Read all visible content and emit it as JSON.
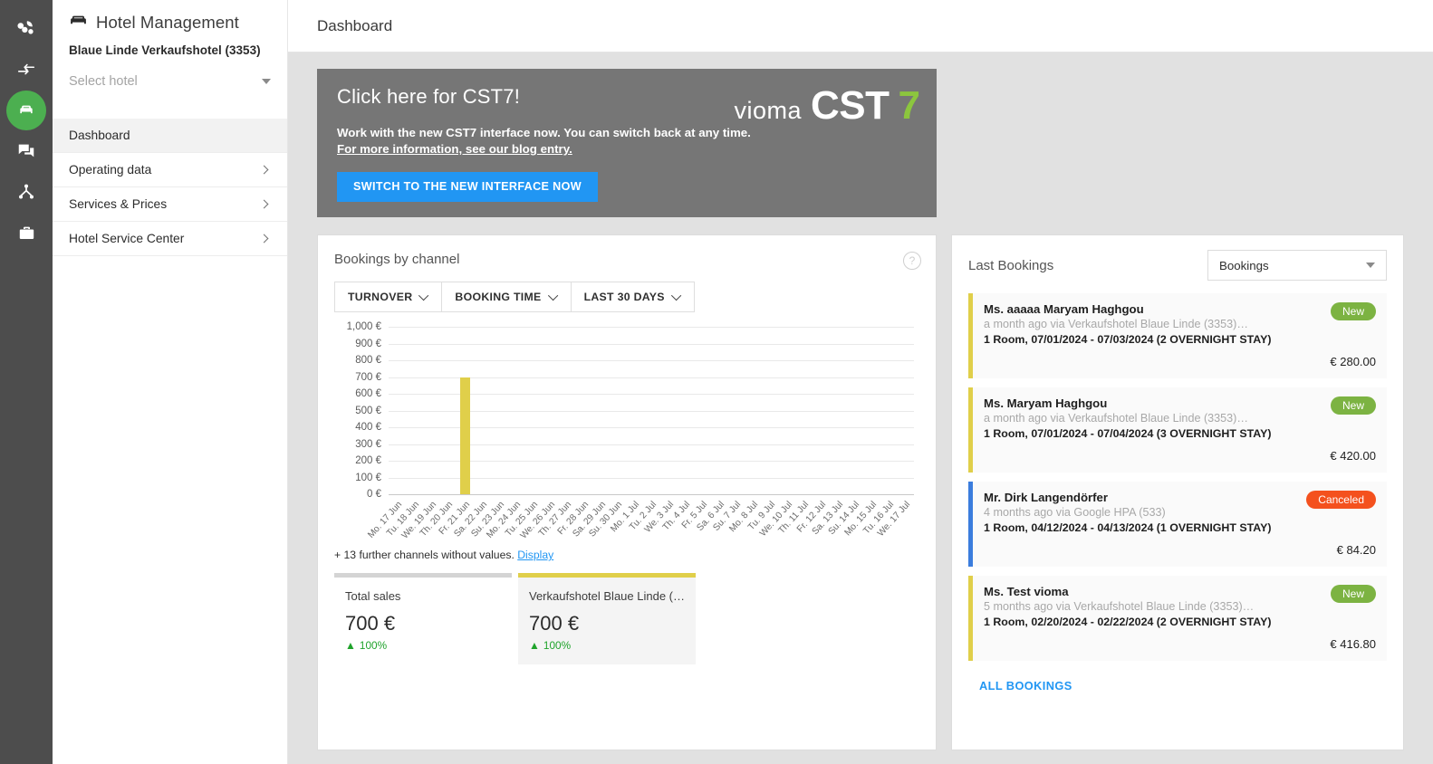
{
  "rail": {
    "items": [
      {
        "name": "analytics-icon",
        "active": false
      },
      {
        "name": "transfer-icon",
        "active": false
      },
      {
        "name": "hotel-icon",
        "active": true
      },
      {
        "name": "chat-icon",
        "active": false
      },
      {
        "name": "sitemap-icon",
        "active": false
      },
      {
        "name": "briefcase-icon",
        "active": false
      }
    ]
  },
  "sidebar": {
    "brand_title": "Hotel Management",
    "brand_icon": "bed-icon",
    "hotel_name": "Blaue Linde Verkaufshotel (3353)",
    "hotel_select_placeholder": "Select hotel",
    "hotel_select_value": "",
    "nav": [
      {
        "label": "Dashboard",
        "has_chevron": false,
        "active": true
      },
      {
        "label": "Operating data",
        "has_chevron": true,
        "active": false
      },
      {
        "label": "Services & Prices",
        "has_chevron": true,
        "active": false
      },
      {
        "label": "Hotel Service Center",
        "has_chevron": true,
        "active": false
      }
    ]
  },
  "header": {
    "page_title": "Dashboard"
  },
  "promo": {
    "heading": "Click here for CST7!",
    "line1": "Work with the new CST7 interface now. You can switch back at any time.",
    "line2": "For more information, see our blog entry.",
    "button_label": "SWITCH TO THE NEW INTERFACE NOW",
    "logo_vioma": "vioma",
    "logo_cst": "CST",
    "logo_7": "7",
    "bg_color": "#767676",
    "button_color": "#2196f3",
    "accent_color": "#8cc63e"
  },
  "chart_panel": {
    "title": "Bookings by channel",
    "help_icon": "question-mark-icon",
    "filters": [
      {
        "label": "TURNOVER"
      },
      {
        "label": "BOOKING TIME"
      },
      {
        "label": "LAST 30 DAYS"
      }
    ],
    "further_text": "+ 13 further channels without values.",
    "further_link": "Display",
    "legend": [
      {
        "label": "Total sales",
        "value": "700 €",
        "delta": "100%",
        "delta_arrow": "▲",
        "color": "#d4d4d4"
      },
      {
        "label": "Verkaufshotel Blaue Linde (…",
        "value": "700 €",
        "delta": "100%",
        "delta_arrow": "▲",
        "color": "#e0cf4a"
      }
    ]
  },
  "chart_data": {
    "type": "bar",
    "title": "Bookings by channel",
    "xlabel": "",
    "ylabel": "",
    "ylim": [
      0,
      1000
    ],
    "grid": true,
    "legend_position": "bottom",
    "yticks": [
      "0 €",
      "100 €",
      "200 €",
      "300 €",
      "400 €",
      "500 €",
      "600 €",
      "700 €",
      "800 €",
      "900 €",
      "1,000 €"
    ],
    "ytick_values": [
      0,
      100,
      200,
      300,
      400,
      500,
      600,
      700,
      800,
      900,
      1000
    ],
    "categories": [
      "Mo. 17 Jun",
      "Tu. 18 Jun",
      "We. 19 Jun",
      "Th. 20 Jun",
      "Fr. 21 Jun",
      "Sa. 22 Jun",
      "Su. 23 Jun",
      "Mo. 24 Jun",
      "Tu. 25 Jun",
      "We. 26 Jun",
      "Th. 27 Jun",
      "Fr. 28 Jun",
      "Sa. 29 Jun",
      "Su. 30 Jun",
      "Mo. 1 Jul",
      "Tu. 2 Jul",
      "We. 3 Jul",
      "Th. 4 Jul",
      "Fr. 5 Jul",
      "Sa. 6 Jul",
      "Su. 7 Jul",
      "Mo. 8 Jul",
      "Tu. 9 Jul",
      "We. 10 Jul",
      "Th. 11 Jul",
      "Fr. 12 Jul",
      "Sa. 13 Jul",
      "Su. 14 Jul",
      "Mo. 15 Jul",
      "Tu. 16 Jul",
      "We. 17 Jul"
    ],
    "series": [
      {
        "name": "Verkaufshotel Blaue Linde (3353)",
        "color": "#e0cf4a",
        "values": [
          0,
          0,
          0,
          0,
          700,
          0,
          0,
          0,
          0,
          0,
          0,
          0,
          0,
          0,
          0,
          0,
          0,
          0,
          0,
          0,
          0,
          0,
          0,
          0,
          0,
          0,
          0,
          0,
          0,
          0,
          0
        ]
      }
    ]
  },
  "last_bookings": {
    "title": "Last Bookings",
    "select_value": "Bookings",
    "all_bookings_label": "ALL BOOKINGS",
    "items": [
      {
        "name": "Ms. aaaaa Maryam Haghgou",
        "meta": "a month ago via Verkaufshotel Blaue Linde (3353)…",
        "detail": "1 Room, 07/01/2024 - 07/03/2024 (2 OVERNIGHT STAY)",
        "badge": "New",
        "badge_type": "new",
        "price": "€ 280.00",
        "accent": "#e0cf4a"
      },
      {
        "name": "Ms. Maryam Haghgou",
        "meta": "a month ago via Verkaufshotel Blaue Linde (3353)…",
        "detail": "1 Room, 07/01/2024 - 07/04/2024 (3 OVERNIGHT STAY)",
        "badge": "New",
        "badge_type": "new",
        "price": "€ 420.00",
        "accent": "#e0cf4a"
      },
      {
        "name": "Mr. Dirk Langendörfer",
        "meta": "4 months ago via Google HPA (533)",
        "detail": "1 Room, 04/12/2024 - 04/13/2024 (1 OVERNIGHT STAY)",
        "badge": "Canceled",
        "badge_type": "canceled",
        "price": "€ 84.20",
        "accent": "#3b7ddd"
      },
      {
        "name": "Ms. Test vioma",
        "meta": "5 months ago via Verkaufshotel Blaue Linde (3353)…",
        "detail": "1 Room, 02/20/2024 - 02/22/2024 (2 OVERNIGHT STAY)",
        "badge": "New",
        "badge_type": "new",
        "price": "€ 416.80",
        "accent": "#e0cf4a"
      }
    ]
  }
}
